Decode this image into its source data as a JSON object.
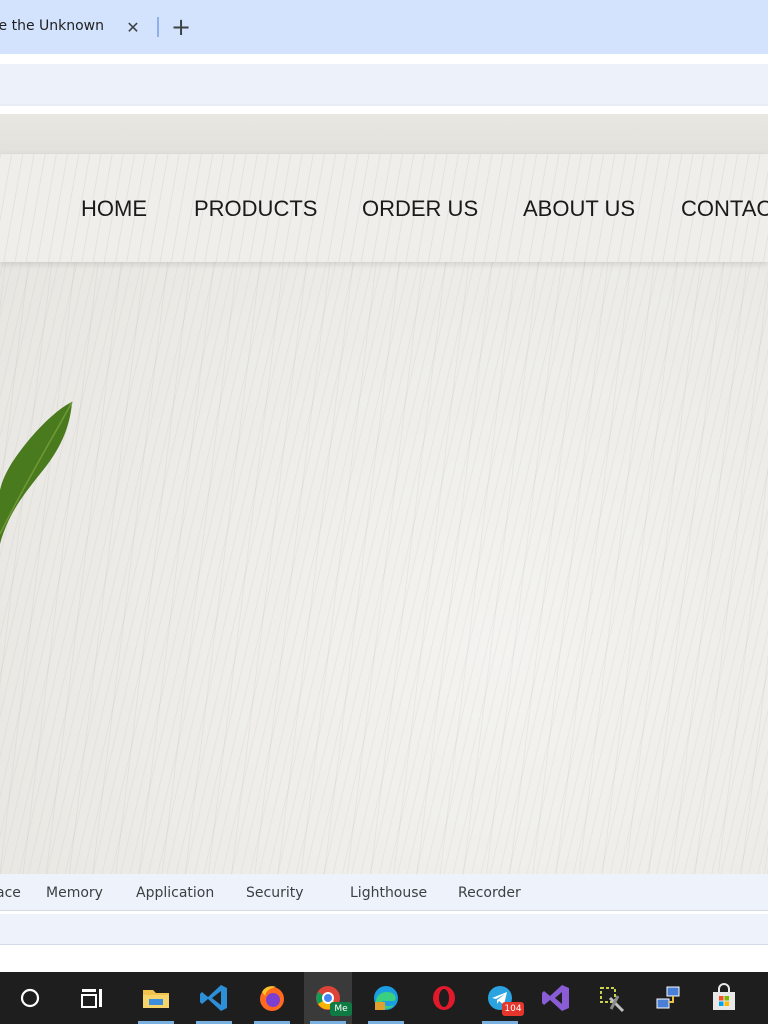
{
  "browser": {
    "tab_title": "e the Unknown",
    "close_glyph": "✕",
    "new_tab_glyph": "+"
  },
  "site": {
    "nav": [
      {
        "label": "HOME"
      },
      {
        "label": "PRODUCTS"
      },
      {
        "label": "ORDER US"
      },
      {
        "label": "ABOUT US"
      },
      {
        "label": "CONTACT"
      }
    ],
    "colors": {
      "leaf": "#4a7a1e",
      "background": "#ecebe7"
    }
  },
  "devtools": {
    "tabs": [
      "ace",
      "Memory",
      "Application",
      "Security",
      "Lighthouse",
      "Recorder"
    ]
  },
  "taskbar": {
    "icons": [
      "cortana-search-icon",
      "task-view-icon",
      "file-explorer-icon",
      "vs-code-icon",
      "firefox-icon",
      "chrome-icon",
      "edge-icon",
      "opera-icon",
      "telegram-icon",
      "visual-studio-icon",
      "tools-icon",
      "network-icon",
      "store-icon"
    ],
    "chrome_badge": "Me",
    "telegram_badge": "104"
  }
}
